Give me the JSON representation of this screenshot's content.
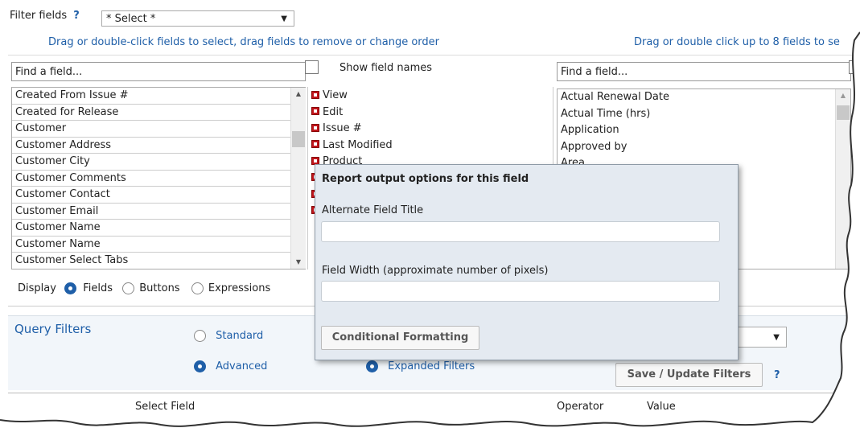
{
  "header": {
    "filter_label": "Filter fields",
    "help_mark": "?",
    "select_value": "* Select *",
    "drag_left_hint": "Drag or double-click fields to select, drag fields to remove or change order",
    "drag_right_hint": "Drag or double click up to 8 fields to se"
  },
  "left_panel": {
    "find_placeholder": "Find a field...",
    "show_field_names_label": "Show field names",
    "items": [
      "Created From Issue #",
      "Created for Release",
      "Customer",
      "Customer Address",
      "Customer City",
      "Customer Comments",
      "Customer Contact",
      "Customer Email",
      "Customer Name",
      "Customer Name",
      "Customer Select Tabs"
    ]
  },
  "selected_panel": {
    "items": [
      "View",
      "Edit",
      "Issue #",
      "Last Modified",
      "Product"
    ]
  },
  "right_panel": {
    "find_placeholder": "Find a field...",
    "items": [
      "Actual Renewal Date",
      "Actual Time (hrs)",
      "Application",
      "Approved by",
      "Area"
    ]
  },
  "display": {
    "label": "Display",
    "options": [
      "Fields",
      "Buttons",
      "Expressions"
    ],
    "selected": "Fields"
  },
  "query_filters": {
    "title": "Query Filters",
    "standard_label": "Standard",
    "advanced_label": "Advanced",
    "mode_selected": "Advanced",
    "expanded_filters_label": "Expanded Filters",
    "save_button": "Save / Update Filters",
    "help_mark": "?"
  },
  "table_header": {
    "select_field": "Select Field",
    "operator": "Operator",
    "value": "Value"
  },
  "popup": {
    "title": "Report output options for this field",
    "alt_title_label": "Alternate Field Title",
    "alt_title_value": "",
    "width_label": "Field Width (approximate number of pixels)",
    "width_value": "",
    "conditional_button": "Conditional Formatting"
  },
  "colors": {
    "accent": "#1f5fa8",
    "popup_bg": "#e4eaf1",
    "marker_red": "#c0141b"
  }
}
